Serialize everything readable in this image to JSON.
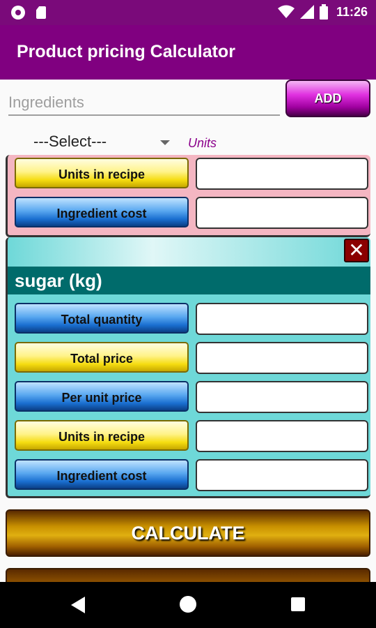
{
  "status_bar": {
    "time": "11:26",
    "icons": [
      "notification-circle-icon",
      "sd-card-icon",
      "wifi-icon",
      "signal-icon",
      "battery-icon"
    ]
  },
  "app_bar": {
    "title": "Product pricing Calculator",
    "color": "#800080"
  },
  "ingredient_input": {
    "placeholder": "Ingredients",
    "value": ""
  },
  "add_button": {
    "label": "ADD"
  },
  "unit_select": {
    "selected": "---Select---"
  },
  "units_label": "Units",
  "partial_card": {
    "rows": [
      {
        "label": "Units in recipe",
        "style": "yellow",
        "value": ""
      },
      {
        "label": "Ingredient cost",
        "style": "blue",
        "value": ""
      }
    ]
  },
  "ingredient_card": {
    "title": "sugar (kg)",
    "close_symbol": "✕",
    "rows": [
      {
        "label": "Total quantity",
        "style": "blue",
        "value": ""
      },
      {
        "label": "Total price",
        "style": "yellow",
        "value": ""
      },
      {
        "label": "Per unit price",
        "style": "blue",
        "value": ""
      },
      {
        "label": "Units in recipe",
        "style": "yellow",
        "value": ""
      },
      {
        "label": "Ingredient cost",
        "style": "blue",
        "value": ""
      }
    ]
  },
  "calculate_button": {
    "label": "CALCULATE"
  }
}
